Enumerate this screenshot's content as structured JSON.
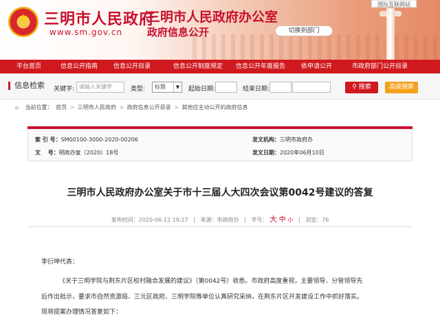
{
  "header": {
    "site_name": "三明市人民政府",
    "site_url": "www.sm.gov.cn",
    "office_name": "三明市人民政府办公室",
    "office_sub": "政府信息公开",
    "switch_label": "切换到部门",
    "badge": "国际互联网站"
  },
  "nav": [
    "平台首页",
    "信息公开指南",
    "信息公开目录",
    "信息公开制度规定",
    "信息公开年度报告",
    "依申请公开",
    "市政府部门公开目录"
  ],
  "search": {
    "title": "信息检索",
    "keyword_label": "关键字:",
    "keyword_placeholder": "请输入关键字",
    "type_label": "类型:",
    "type_value": "标题",
    "start_label": "起始日期:",
    "end_label": "结束日期:",
    "search_button": "搜索",
    "advanced_button": "高级搜索"
  },
  "breadcrumb": {
    "prefix": "当前位置：",
    "items": [
      "首页",
      "三明市人民政府",
      "政府信息公开目录",
      "其他应主动公开的政府信息"
    ],
    "separator": ">"
  },
  "info": {
    "index_label": "索 引 号：",
    "index_value": "SM00100-3000-2020-00206",
    "org_label": "发文机构：",
    "org_value": "三明市政府办",
    "docno_label": "文　 号：",
    "docno_value": "明政办复〔2020〕18号",
    "date_label": "发文日期：",
    "date_value": "2020年06月10日"
  },
  "article": {
    "title": "三明市人民政府办公室关于市十三届人大四次会议第0042号建议的答复",
    "publish_label": "发布时间：",
    "publish_value": "2020-06-12 19:27",
    "source_label": "来源：",
    "source_value": "市政府办",
    "font_label": "字号：",
    "font_big": "大",
    "font_mid": "中",
    "font_small": "小",
    "views_label": "浏览：",
    "views_value": "76",
    "salutation": "李衍坤代表：",
    "para1_line1": "《关于三明学院与荆东片区校村融合发展的建议》（第0042号）收悉。市政府高度重视，主要领导、分管领导先",
    "para1_line2": "后作出批示，要求市自然资源局、三元区政府、三明学院等单位认真研究采纳，在荆东片区开发建设工作中抓好落实。",
    "para2": "现将提案办理情况答复如下："
  },
  "colors": {
    "brand_red": "#d0191f",
    "accent_orange": "#f5a21b"
  }
}
